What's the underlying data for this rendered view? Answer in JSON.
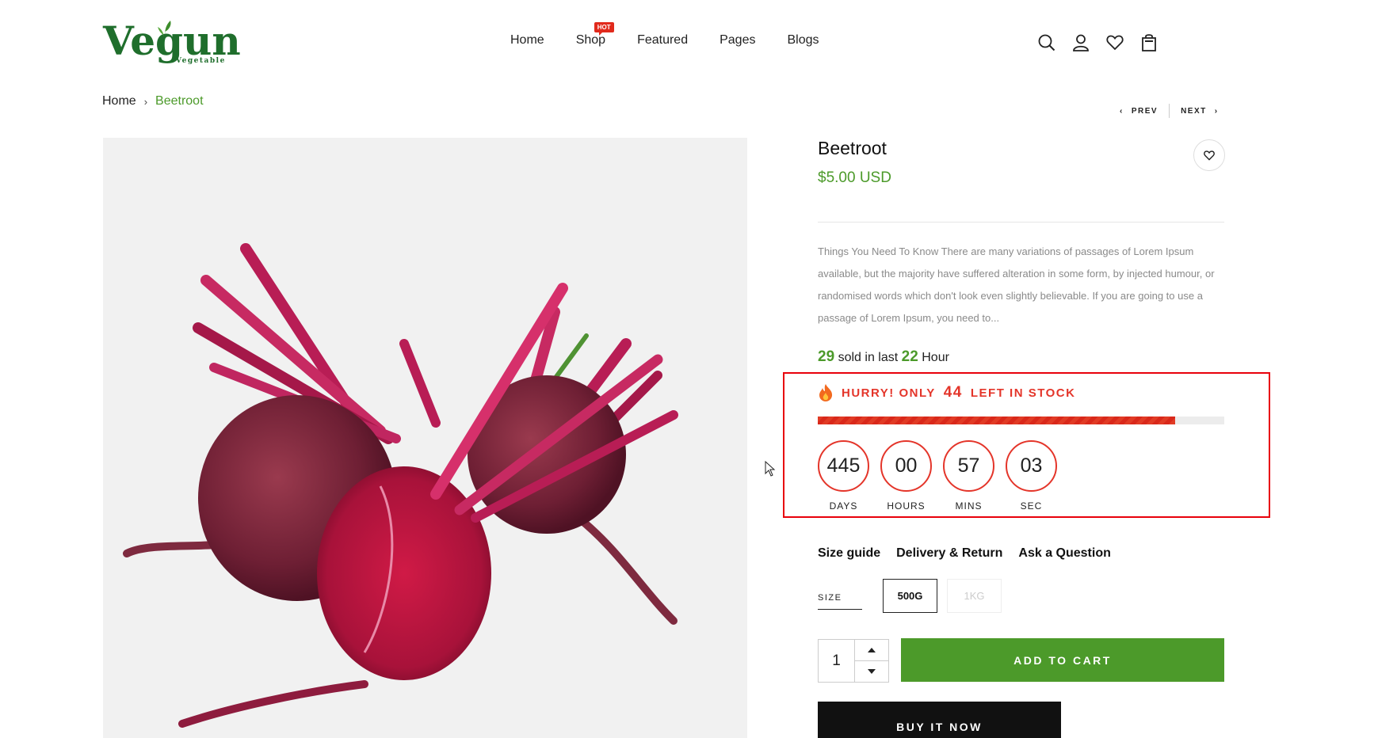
{
  "logo": {
    "main": "Vegun",
    "sub": "Vegetable"
  },
  "nav": {
    "items": [
      {
        "label": "Home"
      },
      {
        "label": "Shop",
        "badge": "HOT"
      },
      {
        "label": "Featured"
      },
      {
        "label": "Pages"
      },
      {
        "label": "Blogs"
      }
    ]
  },
  "header_icons": [
    "search-icon",
    "user-icon",
    "heart-icon",
    "shopping-bag-icon"
  ],
  "breadcrumb": {
    "home": "Home",
    "separator": "›",
    "current": "Beetroot"
  },
  "pager": {
    "prev": "PREV",
    "next": "NEXT"
  },
  "product": {
    "title": "Beetroot",
    "price": "$5.00 USD",
    "description": "Things You Need To Know There are many variations of passages of Lorem Ipsum available, but the majority have suffered alteration in some form, by injected humour, or randomised words which don't look even slightly believable. If you are going to use a passage of Lorem Ipsum, you need to...",
    "sold": {
      "count": "29",
      "text_mid": "sold in last",
      "hours": "22",
      "text_end": "Hour"
    }
  },
  "stock": {
    "prefix": "HURRY! ONLY",
    "count": "44",
    "suffix": "LEFT IN STOCK",
    "progress_fraction": 0.88
  },
  "countdown": [
    {
      "value": "445",
      "label": "DAYS"
    },
    {
      "value": "00",
      "label": "HOURS"
    },
    {
      "value": "57",
      "label": "MINS"
    },
    {
      "value": "03",
      "label": "SEC"
    }
  ],
  "info_links": [
    "Size guide",
    "Delivery & Return",
    "Ask a Question"
  ],
  "size": {
    "label": "SIZE",
    "options": [
      "500G",
      "1KG"
    ],
    "selected": "500G"
  },
  "quantity": {
    "value": "1"
  },
  "buttons": {
    "add_to_cart": "ADD TO CART",
    "buy_now": "BUY IT NOW"
  },
  "colors": {
    "accent_green": "#4c9a2a",
    "logo_green": "#1f6e2c",
    "alert_red": "#e4352a",
    "highlight_border": "#e8000b"
  }
}
